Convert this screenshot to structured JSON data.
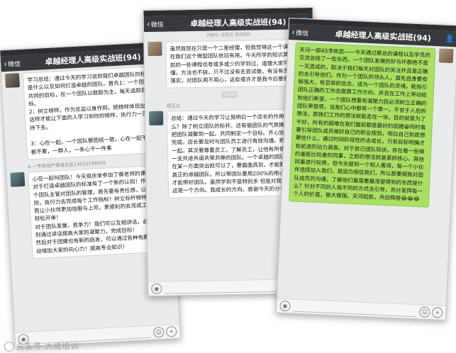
{
  "watermark": "头条号·大成培训",
  "phones": [
    {
      "back_label": "微信",
      "title": "卓越经理人高级实战班(94)",
      "messages": [
        "学习总结：通过今天的学习说到我们卓越团队的标准是什么以及如何打造卓越的团队。首先1：一个团队有共同的目标，在一个团队以鼓励为主，每天追踪目标。\n2：树立榜样，作为总监以身作则，把榜样体现出来，这样才能让下面的人学习到你的榜样，执行力一定坚持下去。\n\n3：心在一起，一个团队要团结一致，心在一起干什么都不累，一群人，一条心干一件事",
        "心在一起叫团队！今天很庆幸参加了蔡老师的课程，对于打造卓越团队的标准有了一个新的认知！作为一个团队主管对团队的管理，首先要有责任感，以身作则，执行力去完成每个工作指标！树立标杆榜样，从而让小伙伴更加信服与上司，更顺利的去完成工作，轻松开单！\n对于团队发展，竞争力！我们可以互相讲话，必须时刻通过讲话提高大家的凝聚力，完成目标！\n然后对于团建也有新的启发，可以通过各种有趣的活动增加大家的向心力！提高专业知识！"
      ],
      "sender2": "A-一亨房地产渠道总监13632196045"
    },
    {
      "back_label": "微信",
      "title": "卓越经理人高级实战班(94)",
      "top_cut": "刘婉仪-百家区·南宛园B",
      "messages": [
        "虽然我现在只是一个二星经理，但我觉得这一个课程放在我们这个微型团队依旧有用。今天所学的知识其实之前的一些课程也有或多或少的学到过，道理大家可能都懂，方法也不缺，只不过没有去尝试做，有没有去坚持落实，对团队用不用心，这些或许才是我今后要做的。",
        "总结：通过今天的学习让我明白一个店长的作用是什么？除了树立团队的标杆。还有做团队的气氛推动者。把团队凝聚到一起。共同制定一个目标。齐心协力将他完成。店长要及时与团队员工进行有效沟通。把心拉到一起。其次要尊重员工，了解员工，让他有所依。打造一支共进共退共荣共辱的团队。一个卓越的团队不单单在某一方面突出就可以了，要面面具到，才能算是一个真正的卓越团队。所以带团队要用200%的用心和耐心才能带好团队。虽然学到不是特别多 但是对我以后来说 这是一个方向。我成长的方向。感谢今天的分享。"
      ],
      "time": "00:00",
      "sender2": "郑正业"
    },
    {
      "back_label": "微信",
      "title": "卓越经理人高级实战班(94)",
      "messages": [
        "天河一部A5李彬武——今天通过蔡总的课程以及学员的交流总结了一些东西，一个团队发展的好与坏都绝不是一天造成的，取决于我们每天对团队的关注并且是正确的去引导他们，作为一个团队的领头人，首先自身要有够强大，有足够的信念，成为一个团队的灵魂，能指引团队正确的工作态度跟工作方向，并且在工作上带动给到他们希望，一个团队想要有凝聚力就必须树立正确的团队荣誉感，当我们心中都有一个第一，不甘于人后的想法，那我们工作的想法就能走在一块，目的就是为了干好，所有的困难在我们面前都是最好的团建😁同时需要引导团队成员做好自己的职业规划，明白自己到底想要些什么，通过时间阶段性的去成长，只有目标明确才有前进的动力源泉。对于自己团队现状，存在着一些微的差距比较差的同事，之前的想法就是紧抓核心，其他同事进行轮换，但今天提到一个知人善用，每一个小伙伴选择加入我们，是因为相信我们，所以那要细致对团队成员的沟通，了解他们最需要最渴望得到的东西是什么？针对不同的人用不同的方式去引导，充分发挥每一个人的价值，做大做强。天河起航，共创辉煌😂😂😂"
      ]
    }
  ],
  "icons": [
    "chevron-left-icon",
    "group-people-icon",
    "voice-icon",
    "emoji-icon",
    "plus-icon"
  ]
}
